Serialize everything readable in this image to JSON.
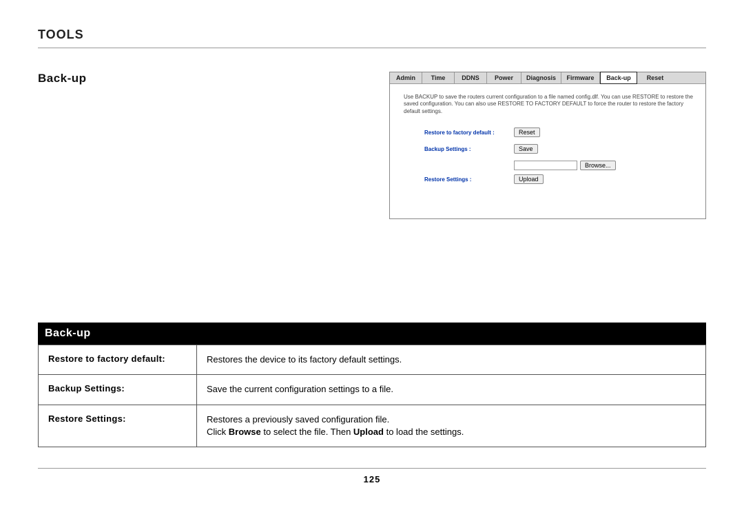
{
  "page": {
    "title": "TOOLS",
    "number": "125"
  },
  "section": {
    "title": "Back-up"
  },
  "panel": {
    "tabs": [
      "Admin",
      "Time",
      "DDNS",
      "Power",
      "Diagnosis",
      "Firmware",
      "Back-up",
      "Reset"
    ],
    "active_tab_index": 6,
    "description": "Use BACKUP to save the routers current configuration to a file named config.dlf. You can use RESTORE to restore the saved configuration. You can also use RESTORE TO FACTORY DEFAULT to force the router to restore the factory default settings.",
    "rows": {
      "restore_default_label": "Restore to factory default :",
      "restore_default_button": "Reset",
      "backup_label": "Backup Settings :",
      "backup_button": "Save",
      "restore_label": "Restore Settings :",
      "browse_button": "Browse...",
      "upload_button": "Upload"
    }
  },
  "table": {
    "header": "Back-up",
    "rows": [
      {
        "label": "Restore to factory default:",
        "text_pre": "Restores the device to its factory default settings.",
        "text_post": ""
      },
      {
        "label": "Backup Settings:",
        "text_pre": "Save the current configuration settings to a file.",
        "text_post": ""
      },
      {
        "label": "Restore Settings:",
        "text_pre": "Restores a previously saved configuration file.",
        "text_post": "Click Browse to select the file. Then Upload to load the settings.",
        "bold1": "Browse",
        "bold2": "Upload",
        "post1": "Click ",
        "post2": " to select the file. Then ",
        "post3": " to load the settings."
      }
    ]
  }
}
